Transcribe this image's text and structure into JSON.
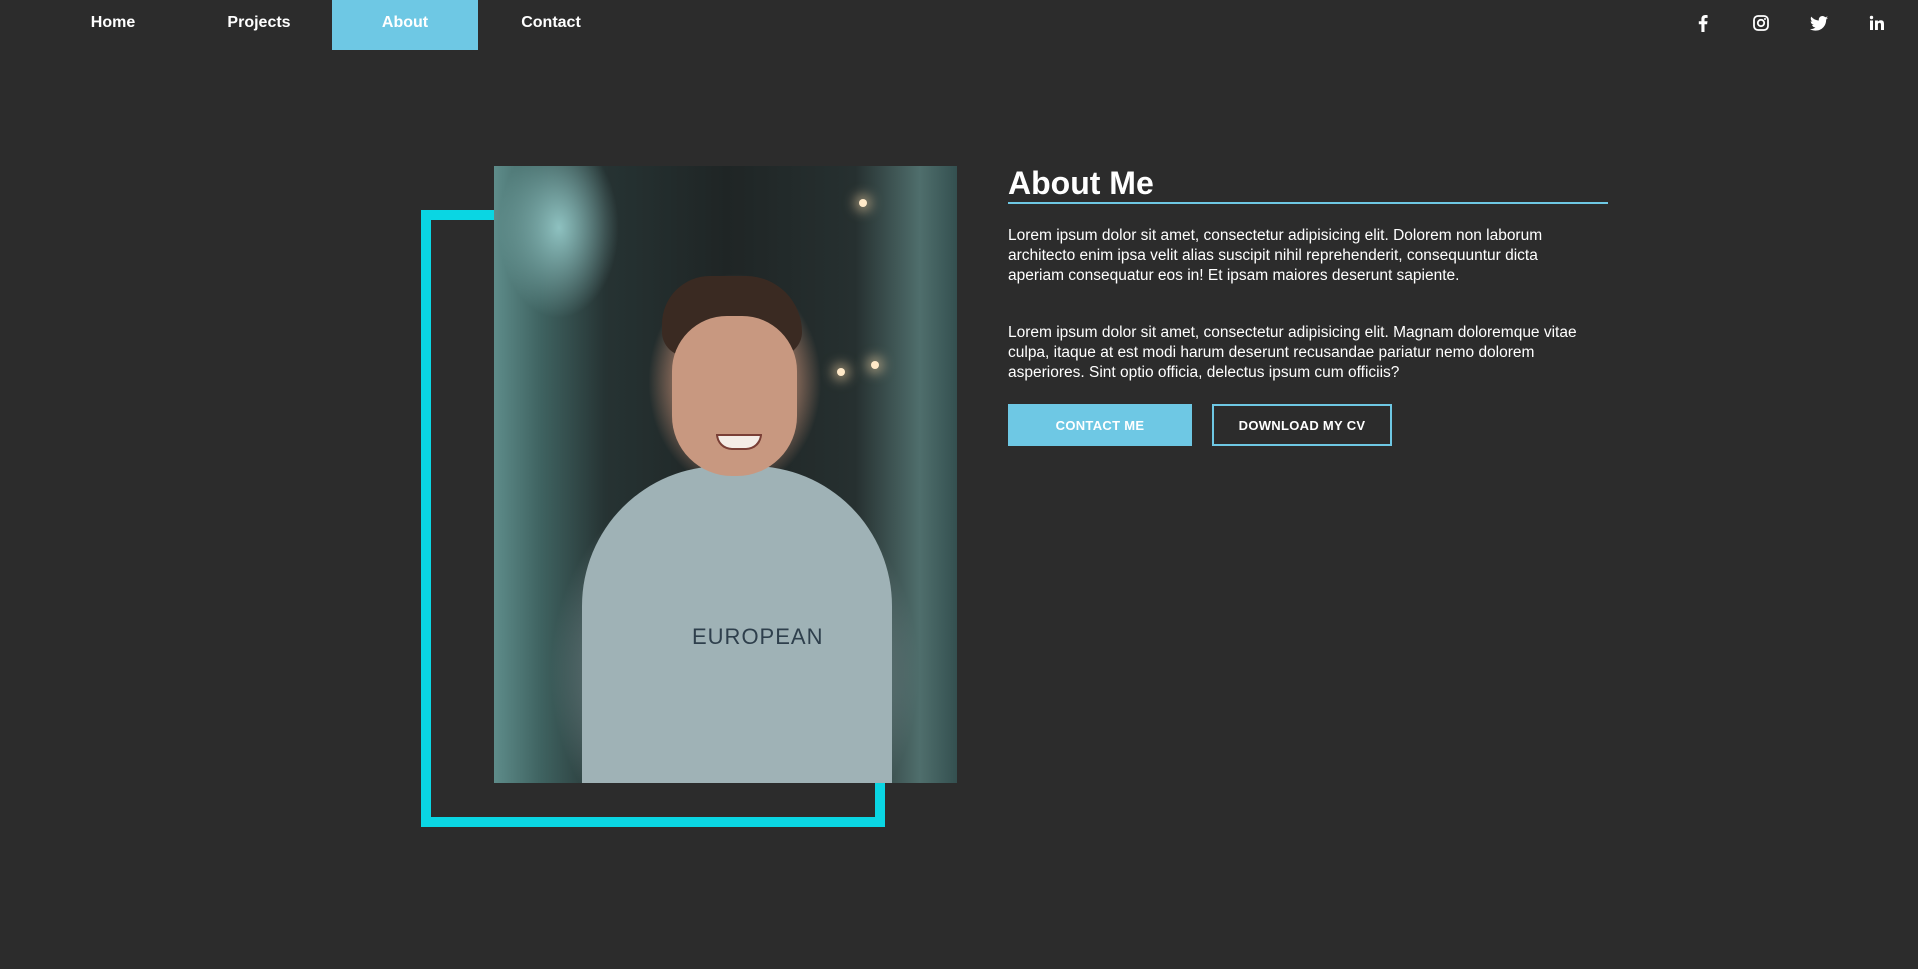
{
  "nav": {
    "items": [
      {
        "label": "Home",
        "active": false
      },
      {
        "label": "Projects",
        "active": false
      },
      {
        "label": "About",
        "active": true
      },
      {
        "label": "Contact",
        "active": false
      }
    ],
    "socials": [
      "facebook-icon",
      "instagram-icon",
      "twitter-icon",
      "linkedin-icon"
    ]
  },
  "about": {
    "title": "About Me",
    "paragraph_1": "Lorem ipsum dolor sit amet, consectetur adipisicing elit. Dolorem non laborum architecto enim ipsa velit alias suscipit nihil reprehenderit, consequuntur dicta aperiam consequatur eos in! Et ipsam maiores deserunt sapiente.",
    "paragraph_2": "Lorem ipsum dolor sit amet, consectetur adipisicing elit. Magnam doloremque vitae culpa, itaque at est modi harum deserunt recusandae pariatur nemo dolorem asperiores. Sint optio officia, delectus ipsum cum officiis?",
    "contact_button": "CONTACT ME",
    "cv_button": "DOWNLOAD MY CV"
  },
  "photo": {
    "hoodie_text": "EUROPEAN"
  },
  "colors": {
    "background": "#2c2c2c",
    "accent": "#6ec8e4",
    "frame": "#0ad6e3",
    "text": "#ffffff"
  }
}
